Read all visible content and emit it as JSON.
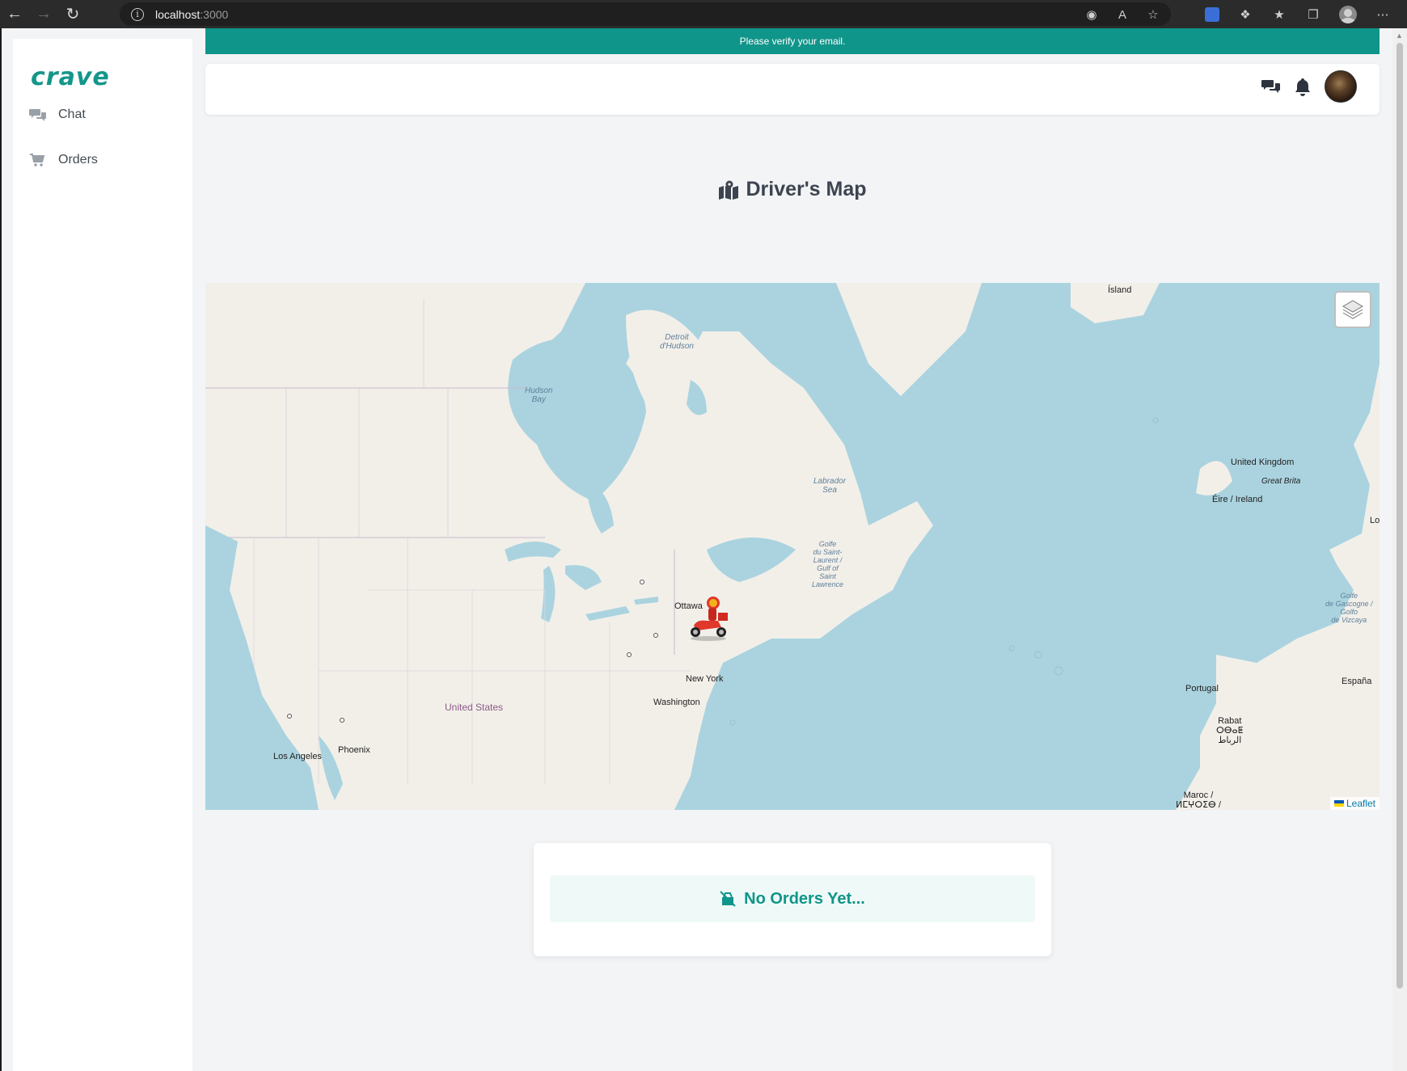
{
  "browser": {
    "url_host": "localhost",
    "url_port": ":3000"
  },
  "sidebar": {
    "logo": "crave",
    "items": [
      {
        "label": "Chat",
        "icon": "chat-bubbles-icon"
      },
      {
        "label": "Orders",
        "icon": "cart-icon"
      }
    ]
  },
  "banner": {
    "text": "Please verify your email."
  },
  "header": {
    "icons": [
      "chat-bubbles-icon",
      "bell-icon",
      "avatar"
    ]
  },
  "page": {
    "title": "Driver's Map"
  },
  "map": {
    "labels": {
      "hudson": "Hudson\nBay",
      "detroit": "Detroit\nd'Hudson",
      "labrador": "Labrador\nSea",
      "golfe": "Golfe\ndu Saint-\nLaurent /\nGulf of\nSaint\nLawrence",
      "island": "Ísland",
      "uk": "United Kingdom",
      "great_britain": "Great Brita",
      "eire": "Éire / Ireland",
      "lo": "Lo",
      "biscay": "Golfe\nde Gascogne /\nGolfo\nde Vizcaya",
      "portugal": "Portugal",
      "espana": "España",
      "rabat": "Rabat\nⵔⴱⴰⵟ\nالرباط",
      "maroc": "Maroc /\nⵍⵎⵖⵔⵉⴱ /",
      "ottawa": "Ottawa",
      "new_york": "New York",
      "washington": "Washington",
      "united_states": "United States",
      "phoenix": "Phoenix",
      "los_angeles": "Los Angeles"
    },
    "attribution": "Leaflet"
  },
  "orders": {
    "empty_text": "No Orders Yet..."
  },
  "colors": {
    "accent": "#10958a",
    "water": "#aad3df",
    "land": "#f2efe9"
  }
}
